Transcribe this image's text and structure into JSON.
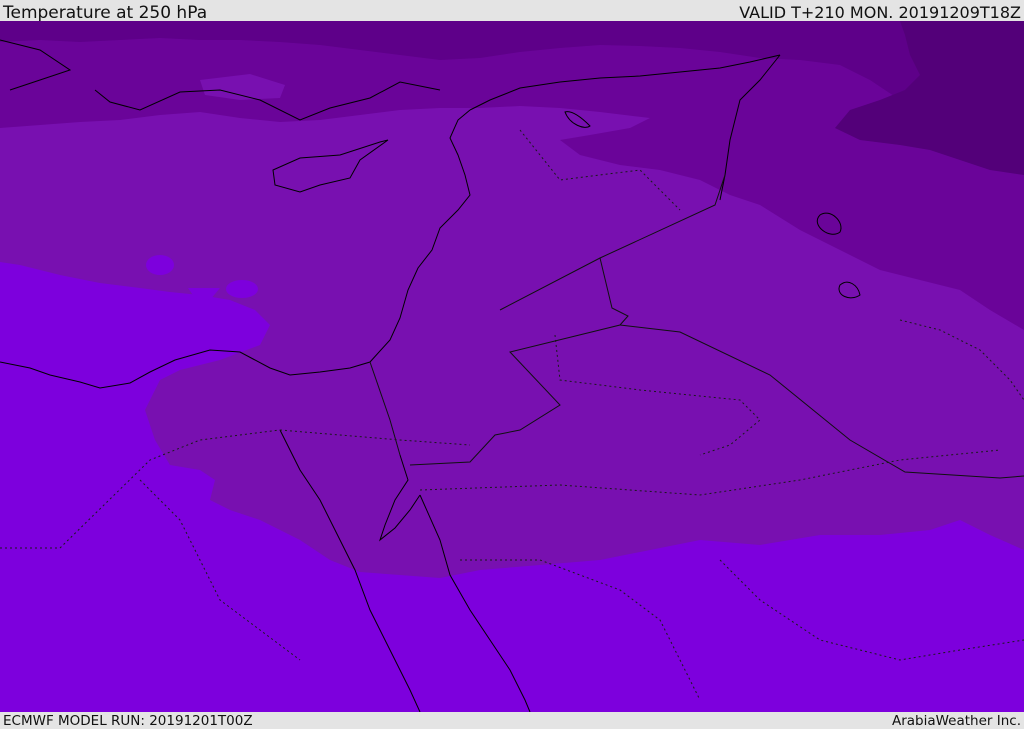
{
  "header": {
    "title": "Temperature at 250 hPa",
    "valid_time": "VALID T+210 MON. 20191209T18Z"
  },
  "footer": {
    "model_run": "ECMWF MODEL RUN: 20191201T00Z",
    "credit": "ArabiaWeather Inc."
  },
  "map": {
    "region": "Eastern Mediterranean and Middle East",
    "field": "temperature",
    "colors": {
      "warmest": "#7d00dd",
      "warm": "#7810b0",
      "mid": "#6a0499",
      "cold": "#5e0089",
      "coldest": "#530079",
      "coastline": "#000000",
      "border": "#101010"
    }
  }
}
